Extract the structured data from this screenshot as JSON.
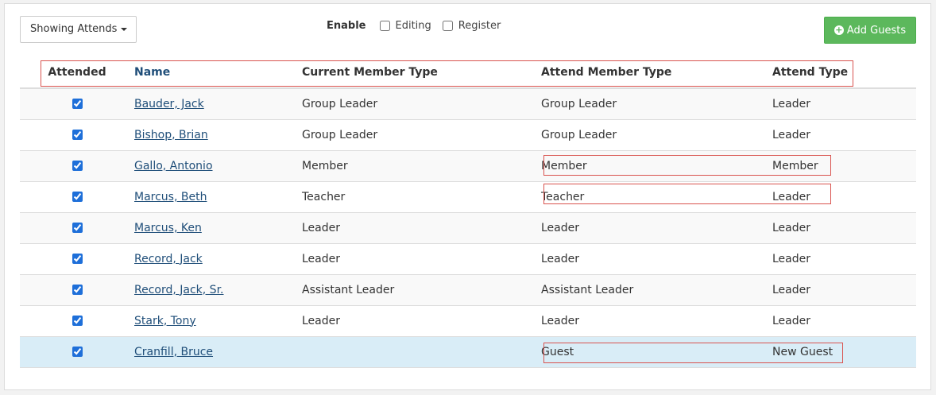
{
  "toolbar": {
    "showing_label": "Showing Attends",
    "enable_label": "Enable",
    "editing_label": "Editing",
    "register_label": "Register",
    "add_guests_label": "Add Guests"
  },
  "table": {
    "headers": {
      "attended": "Attended",
      "name": "Name",
      "current_member_type": "Current Member Type",
      "attend_member_type": "Attend Member Type",
      "attend_type": "Attend Type"
    },
    "rows": [
      {
        "name": "Bauder, Jack",
        "current": "Group Leader",
        "attend_member": "Group Leader",
        "attend_type": "Leader",
        "attended": true
      },
      {
        "name": "Bishop, Brian",
        "current": "Group Leader",
        "attend_member": "Group Leader",
        "attend_type": "Leader",
        "attended": true
      },
      {
        "name": "Gallo, Antonio",
        "current": "Member",
        "attend_member": "Member",
        "attend_type": "Member",
        "attended": true
      },
      {
        "name": "Marcus, Beth",
        "current": "Teacher",
        "attend_member": "Teacher",
        "attend_type": "Leader",
        "attended": true
      },
      {
        "name": "Marcus, Ken",
        "current": "Leader",
        "attend_member": "Leader",
        "attend_type": "Leader",
        "attended": true
      },
      {
        "name": "Record, Jack",
        "current": "Leader",
        "attend_member": "Leader",
        "attend_type": "Leader",
        "attended": true
      },
      {
        "name": "Record, Jack, Sr.",
        "current": "Assistant Leader",
        "attend_member": "Assistant Leader",
        "attend_type": "Leader",
        "attended": true
      },
      {
        "name": "Stark, Tony",
        "current": "Leader",
        "attend_member": "Leader",
        "attend_type": "Leader",
        "attended": true
      },
      {
        "name": "Cranfill, Bruce",
        "current": "",
        "attend_member": "Guest",
        "attend_type": "New Guest",
        "attended": true
      }
    ]
  },
  "colors": {
    "accent_green": "#5cb85c",
    "link_blue": "#1f4e79",
    "highlight_red": "#d9534f",
    "guest_row": "#d9edf7"
  }
}
